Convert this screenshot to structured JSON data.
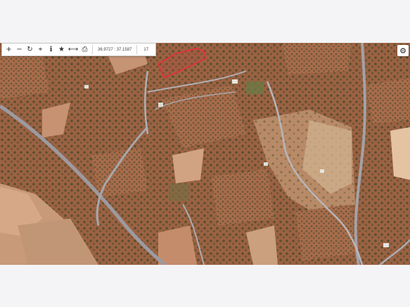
{
  "toolbar": {
    "coordinates": "36.9727 : 37.1587",
    "zoom_level": "17",
    "icons": [
      "zoom-in-icon",
      "zoom-out-icon",
      "refresh-icon",
      "locate-icon",
      "info-icon",
      "star-icon",
      "measure-icon",
      "print-icon"
    ]
  },
  "map": {
    "type": "satellite",
    "parcel_highlight_color": "#e0343c"
  },
  "settings": {
    "icon": "gear-icon"
  }
}
